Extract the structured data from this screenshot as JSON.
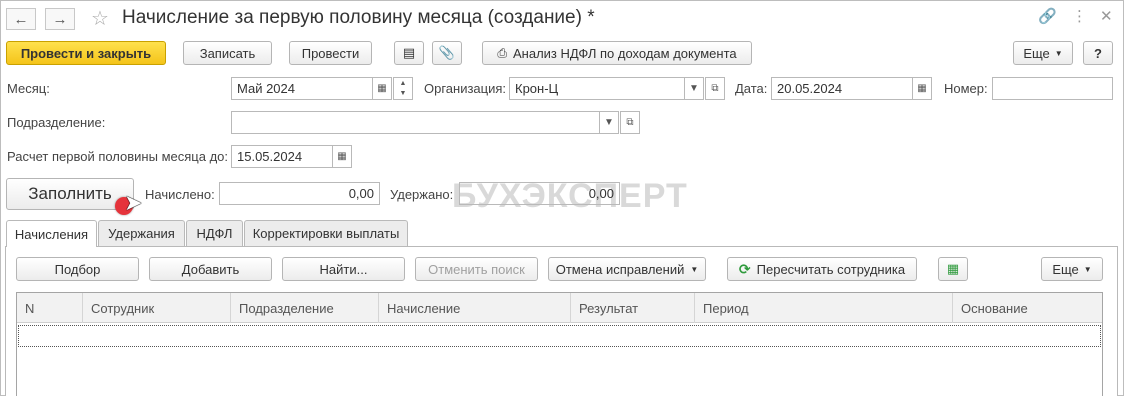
{
  "window": {
    "title": "Начисление за первую половину месяца (создание) *"
  },
  "toolbar": {
    "post_close": "Провести и закрыть",
    "save": "Записать",
    "post": "Провести",
    "ndfl_analysis": "Анализ НДФЛ по доходам документа",
    "more": "Еще",
    "help": "?"
  },
  "form": {
    "month_label": "Месяц:",
    "month_value": "Май 2024",
    "org_label": "Организация:",
    "org_value": "Крон-Ц",
    "date_label": "Дата:",
    "date_value": "20.05.2024",
    "number_label": "Номер:",
    "number_value": "",
    "dept_label": "Подразделение:",
    "dept_value": "",
    "calc_until_label": "Расчет первой половины месяца до:",
    "calc_until_value": "15.05.2024",
    "fill_button": "Заполнить",
    "accrued_label": "Начислено:",
    "accrued_value": "0,00",
    "withheld_label": "Удержано:",
    "withheld_value": "0,00"
  },
  "watermark": "БУХЭКСПЕРТ",
  "tabs": [
    {
      "label": "Начисления",
      "active": true
    },
    {
      "label": "Удержания",
      "active": false
    },
    {
      "label": "НДФЛ",
      "active": false
    },
    {
      "label": "Корректировки выплаты",
      "active": false
    }
  ],
  "table_toolbar": {
    "select": "Подбор",
    "add": "Добавить",
    "find": "Найти...",
    "cancel_search": "Отменить поиск",
    "cancel_corrections": "Отмена исправлений",
    "recalc_employee": "Пересчитать сотрудника",
    "more": "Еще"
  },
  "table": {
    "columns": [
      "N",
      "Сотрудник",
      "Подразделение",
      "Начисление",
      "Результат",
      "Период",
      "Основание"
    ],
    "rows": []
  }
}
